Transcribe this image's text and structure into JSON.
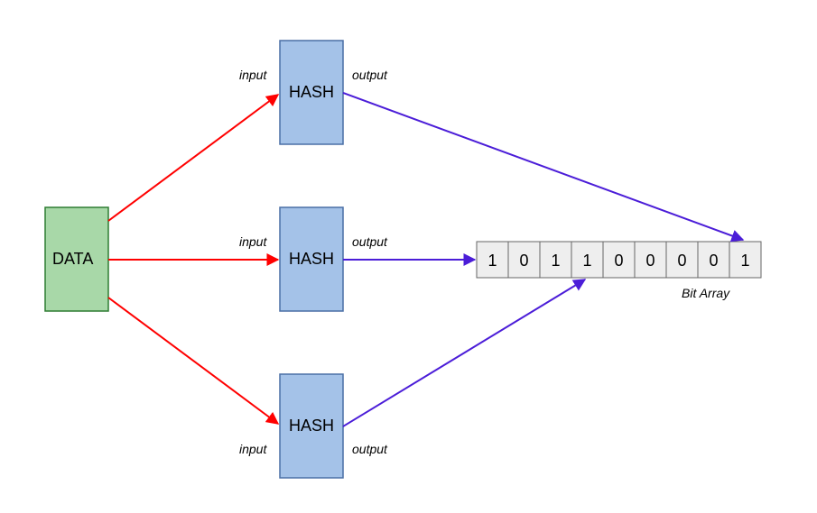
{
  "data_box": {
    "label": "DATA"
  },
  "hash_boxes": [
    {
      "label": "HASH",
      "input_label": "input",
      "output_label": "output"
    },
    {
      "label": "HASH",
      "input_label": "input",
      "output_label": "output"
    },
    {
      "label": "HASH",
      "input_label": "input",
      "output_label": "output"
    }
  ],
  "bit_array": {
    "label": "Bit Array",
    "bits": [
      "1",
      "0",
      "1",
      "1",
      "0",
      "0",
      "0",
      "0",
      "1"
    ]
  },
  "colors": {
    "data_fill": "#a8d8a8",
    "data_stroke": "#2e7d32",
    "hash_fill": "#a4c2e8",
    "hash_stroke": "#4a6fa5",
    "cell_fill": "#eeeeee",
    "cell_stroke": "#666666",
    "arrow_input": "#ff0000",
    "arrow_output": "#4b1dd8"
  }
}
